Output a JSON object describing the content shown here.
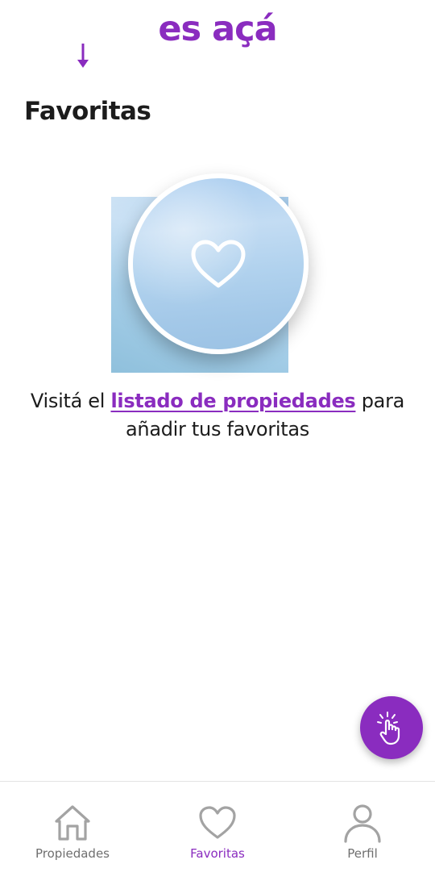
{
  "header": {
    "logo_text": "es açá"
  },
  "page": {
    "title": "Favoritas"
  },
  "empty_state": {
    "illustration_icon": "heart-icon",
    "message_before": "Visitá el ",
    "link_text": "listado de propiedades",
    "message_after": " para añadir tus favoritas"
  },
  "fab": {
    "icon": "tap-hand-icon"
  },
  "bottom_nav": {
    "items": [
      {
        "label": "Propiedades",
        "icon": "home-icon",
        "active": false
      },
      {
        "label": "Favoritas",
        "icon": "heart-icon",
        "active": true
      },
      {
        "label": "Perfil",
        "icon": "user-icon",
        "active": false
      }
    ]
  },
  "colors": {
    "brand": "#8a2cbf",
    "text": "#1c1c1c",
    "nav_inactive": "#6f6f6f",
    "icon_inactive": "#a3a3a3"
  }
}
